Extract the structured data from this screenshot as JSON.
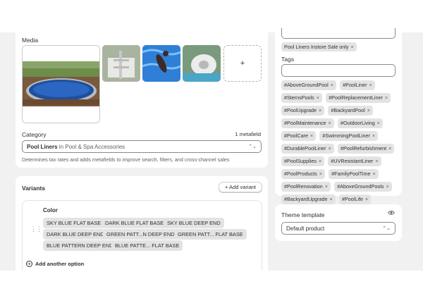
{
  "media": {
    "label": "Media",
    "add_symbol": "+"
  },
  "category": {
    "label": "Category",
    "metafield_badge": "1 metafield",
    "value_bold": "Pool Liners",
    "value_rest": " in Pool & Spa Accessories",
    "helper": "Determines tax rates and adds metafields to improve search, filters, and cross-channel sales"
  },
  "variants": {
    "title": "Variants",
    "add_button": "+ Add variant",
    "option_name": "Color",
    "values": [
      "SKY BLUE FLAT BASE",
      "DARK BLUE FLAT BASE",
      "SKY BLUE DEEP END",
      "DARK BLUE DEEP END",
      "GREEN PATT...N DEEP END",
      "GREEN PATT... FLAT BASE",
      "BLUE PATTERN DEEP END",
      "BLUE PATTE... FLAT BASE"
    ],
    "add_option": "Add another option"
  },
  "sales_channel_tag": "Pool Liners Instore Sale only",
  "tags": {
    "label": "Tags",
    "items": [
      "#AboveGroundPool",
      "#PoolLiner",
      "#SternsPools",
      "#PoolReplacementLiner",
      "#PoolUpgrade",
      "#BackyardPool",
      "#PoolMaintenance",
      "#OutdoorLiving",
      "#PoolCare",
      "#SwimmingPoolLiner",
      "#DurablePoolLiner",
      "#PoolRefurbishment",
      "#PoolSupplies",
      "#UVResistantLiner",
      "#PoolProducts",
      "#FamilyPoolTime",
      "#PoolRenovation",
      "#AboveGroundPools",
      "#BackyardUpgrade",
      "#PoolLife"
    ]
  },
  "theme": {
    "label": "Theme template",
    "value": "Default product"
  }
}
